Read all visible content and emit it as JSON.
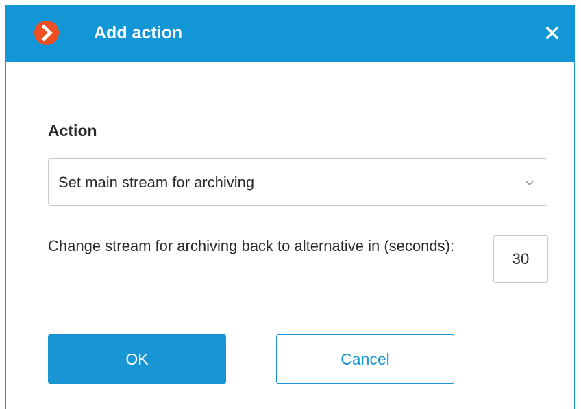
{
  "dialog": {
    "title": "Add action"
  },
  "action": {
    "label": "Action",
    "selected": "Set main stream for archiving"
  },
  "stream_back": {
    "label": "Change stream for archiving back to alternative in (seconds):",
    "value": "30"
  },
  "buttons": {
    "ok_label": "OK",
    "cancel_label": "Cancel"
  },
  "icons": {
    "logo": "app-logo-icon",
    "close": "close-icon",
    "dropdown": "chevron-down-icon"
  },
  "colors": {
    "accent": "#1296d6",
    "logo": "#f04e23"
  }
}
